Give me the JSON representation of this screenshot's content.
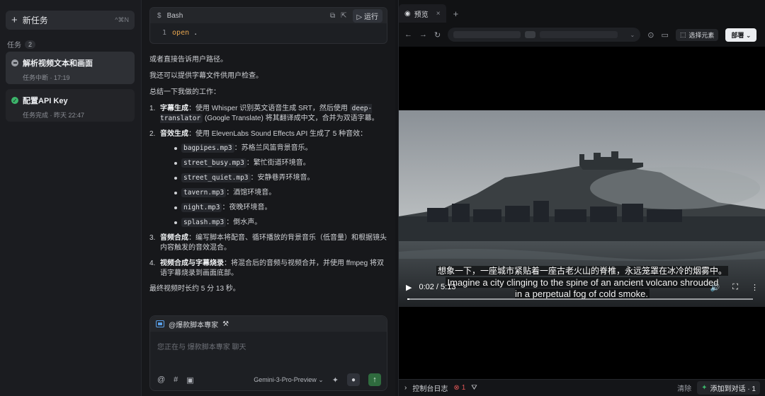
{
  "sidebar": {
    "new_task_label": "新任务",
    "new_task_shortcut": "^⌘N",
    "tasks_label": "任务",
    "tasks_count": "2",
    "tasks": [
      {
        "title": "解析视频文本和画面",
        "subtitle": "任务中断 · 17:19",
        "status": "paused"
      },
      {
        "title": "配置API Key",
        "subtitle": "任务完成 · 昨天 22:47",
        "status": "done"
      }
    ]
  },
  "bash": {
    "title": "Bash",
    "run_label": "运行",
    "line_number": "1",
    "command": "open",
    "argument": "."
  },
  "message": {
    "p1": "或者直接告诉用户路径。",
    "p2": "我还可以提供字幕文件供用户检查。",
    "p3": "总结一下我做的工作：",
    "item1_num": "1.",
    "item1_title": "字幕生成",
    "item1_a": "：使用 Whisper 识别英文语音生成 SRT，然后使用",
    "item1_code": "deep-translator",
    "item1_b": "(Google Translate) 将其翻译成中文，合并为双语字幕。",
    "item2_num": "2.",
    "item2_title": "音效生成",
    "item2_a": "：使用 ElevenLabs Sound Effects API 生成了 5 种音效：",
    "sounds": [
      {
        "file": "bagpipes.mp3",
        "desc": "：苏格兰风笛背景音乐。"
      },
      {
        "file": "street_busy.mp3",
        "desc": "：繁忙街道环境音。"
      },
      {
        "file": "street_quiet.mp3",
        "desc": "：安静巷弄环境音。"
      },
      {
        "file": "tavern.mp3",
        "desc": "：酒馆环境音。"
      },
      {
        "file": "night.mp3",
        "desc": "：夜晚环境音。"
      },
      {
        "file": "splash.mp3",
        "desc": "：倒水声。"
      }
    ],
    "item3_num": "3.",
    "item3_title": "音频合成",
    "item3_a": "：编写脚本将配音、循环播放的背景音乐（低音量）和根据镜头内容触发的音效混合。",
    "item4_num": "4.",
    "item4_title": "视频合成与字幕烧录",
    "item4_a": "：将混合后的音频与视频合并，并使用 ffmpeg 将双语字幕烧录到画面底部。",
    "final": "最终视频时长约 5 分 13 秒。"
  },
  "composer": {
    "agent": "@爆款脚本專家",
    "placeholder": "您正在与 爆款脚本專家 聊天",
    "model": "Gemini-3-Pro-Preview"
  },
  "preview": {
    "tab_label": "预览",
    "select_element_label": "选择元素",
    "deploy_label": "部署",
    "subtitle_zh": "想象一下，一座城市紧贴着一座古老火山的脊椎，永远笼罩在冰冷的烟雾中。",
    "subtitle_en": "Imagine a city clinging to the spine of an ancient volcano shrouded in a perpetual fog of cold smoke.",
    "time": "0:02 / 5:13",
    "progress": 0.006
  },
  "console": {
    "label": "控制台日志",
    "error_count": "1",
    "clear_label": "清除",
    "add_to_chat_label": "添加到对话 · 1"
  }
}
